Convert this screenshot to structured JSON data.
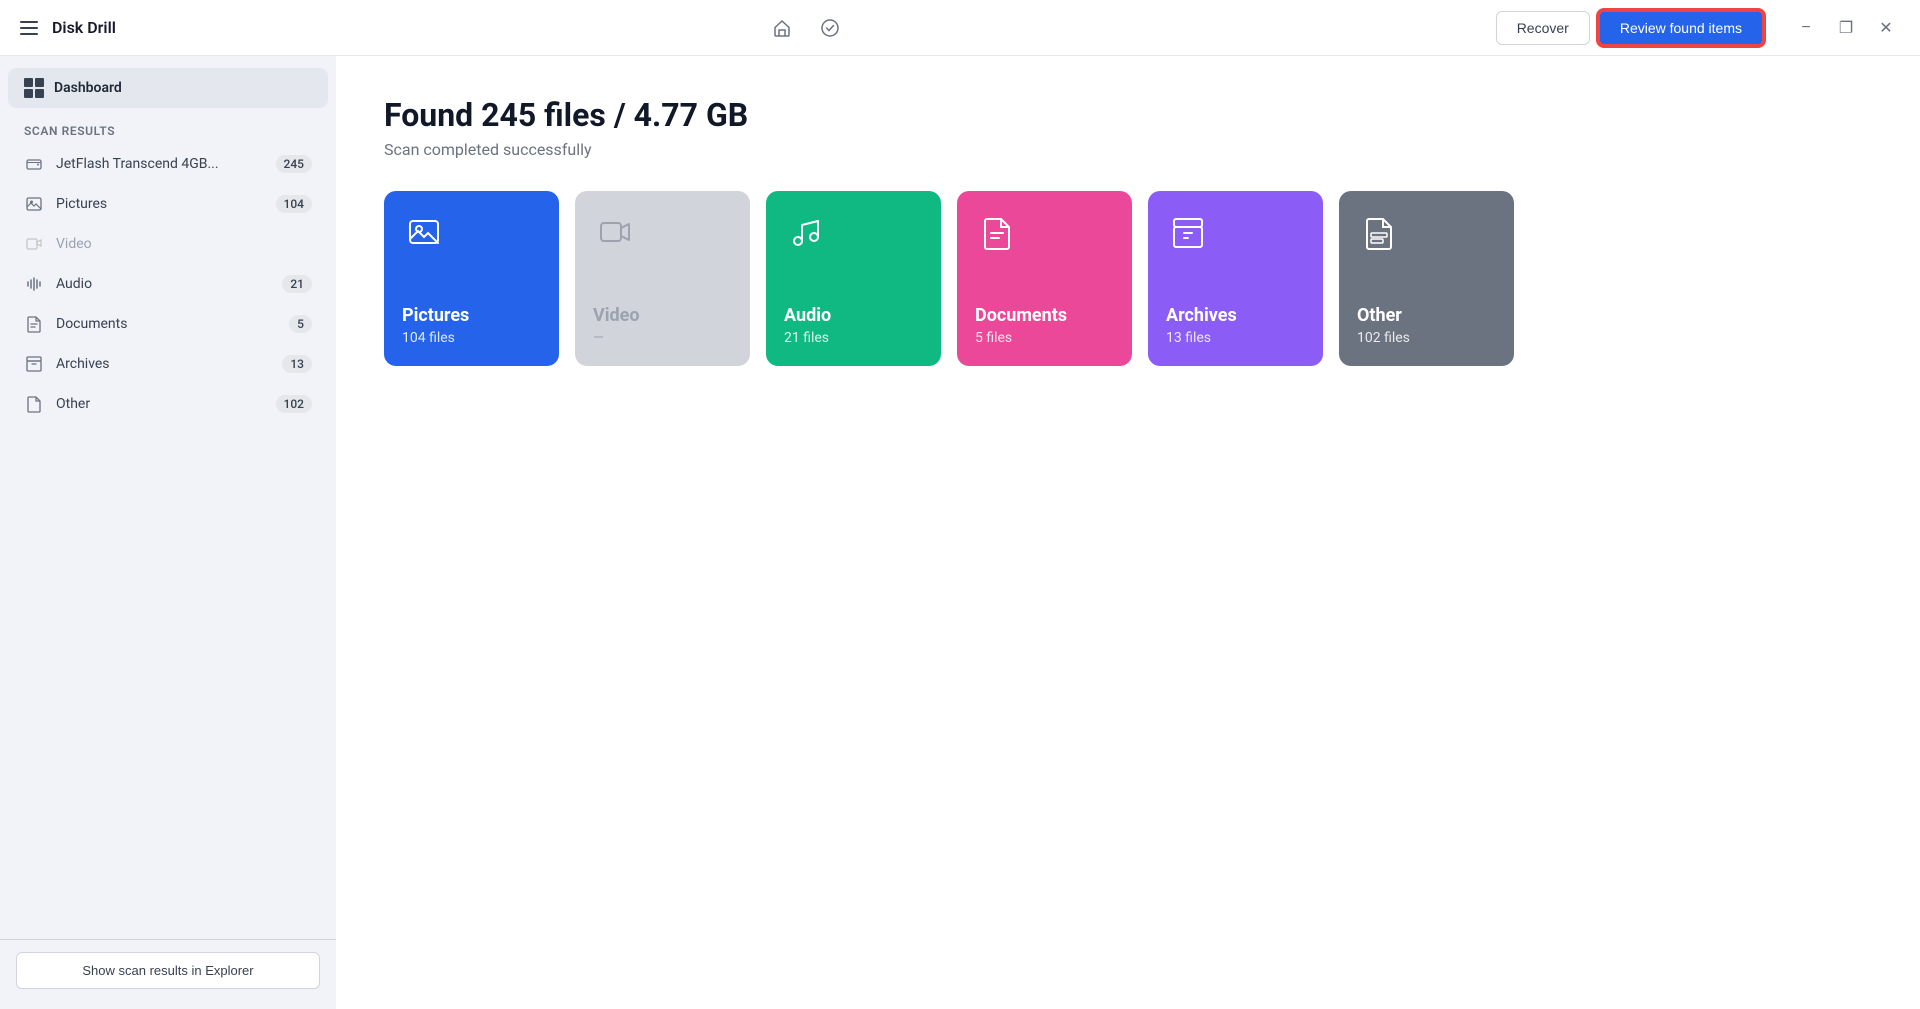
{
  "app": {
    "title": "Disk Drill",
    "hamburger_label": "menu"
  },
  "titlebar": {
    "recover_label": "Recover",
    "review_label": "Review found items",
    "minimize_label": "−",
    "maximize_label": "❐",
    "close_label": "✕"
  },
  "sidebar": {
    "dashboard_label": "Dashboard",
    "section_title": "Scan results",
    "items": [
      {
        "id": "jetflash",
        "label": "JetFlash Transcend 4GB...",
        "count": "245",
        "icon": "drive-icon"
      },
      {
        "id": "pictures",
        "label": "Pictures",
        "count": "104",
        "icon": "pictures-icon"
      },
      {
        "id": "video",
        "label": "Video",
        "count": "",
        "icon": "video-icon",
        "muted": true
      },
      {
        "id": "audio",
        "label": "Audio",
        "count": "21",
        "icon": "audio-icon"
      },
      {
        "id": "documents",
        "label": "Documents",
        "count": "5",
        "icon": "documents-icon"
      },
      {
        "id": "archives",
        "label": "Archives",
        "count": "13",
        "icon": "archives-icon"
      },
      {
        "id": "other",
        "label": "Other",
        "count": "102",
        "icon": "other-icon"
      }
    ],
    "footer_button": "Show scan results in Explorer"
  },
  "main": {
    "found_title": "Found 245 files / 4.77 GB",
    "scan_status": "Scan completed successfully",
    "categories": [
      {
        "id": "pictures",
        "name": "Pictures",
        "count": "104 files",
        "color": "pictures"
      },
      {
        "id": "video",
        "name": "Video",
        "count": "—",
        "color": "video"
      },
      {
        "id": "audio",
        "name": "Audio",
        "count": "21 files",
        "color": "audio"
      },
      {
        "id": "documents",
        "name": "Documents",
        "count": "5 files",
        "color": "documents"
      },
      {
        "id": "archives",
        "name": "Archives",
        "count": "13 files",
        "color": "archives"
      },
      {
        "id": "other",
        "name": "Other",
        "count": "102 files",
        "color": "other"
      }
    ]
  }
}
